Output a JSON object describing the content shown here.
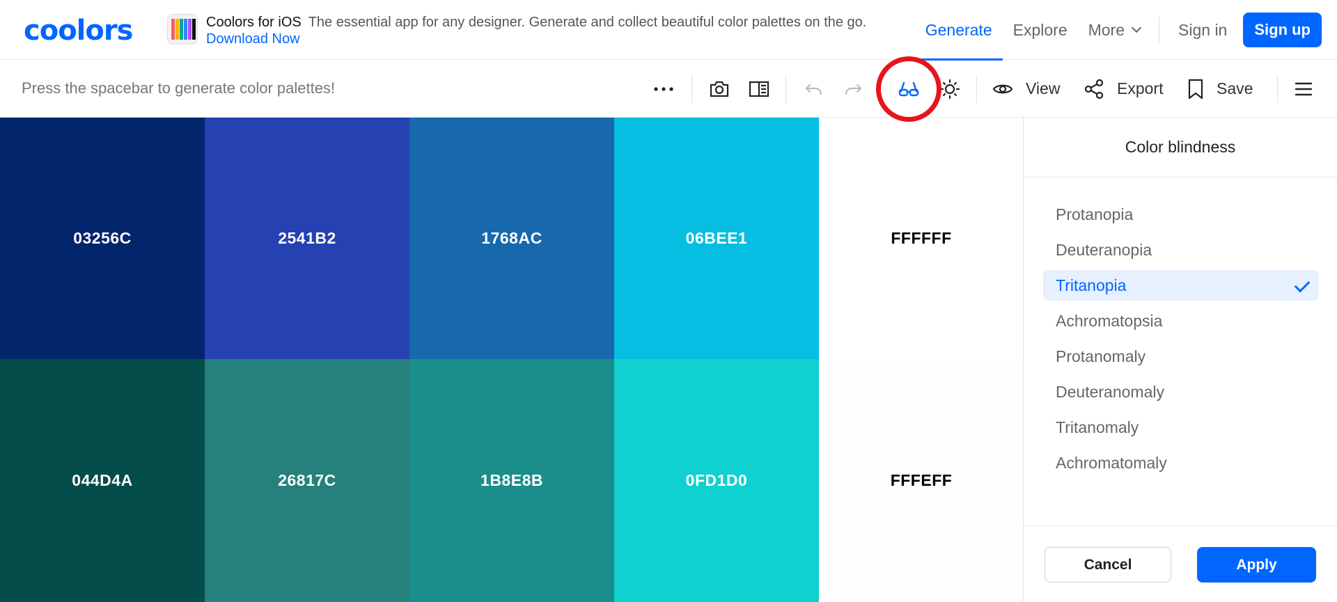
{
  "app": {
    "logo": "coolors"
  },
  "promo": {
    "title": "Coolors for iOS",
    "text": "The essential app for any designer. Generate and collect beautiful color palettes on the go.",
    "link": "Download Now"
  },
  "nav": {
    "generate": "Generate",
    "explore": "Explore",
    "more": "More",
    "sign_in": "Sign in",
    "sign_up": "Sign up"
  },
  "toolbar": {
    "hint": "Press the spacebar to generate color palettes!",
    "view": "View",
    "export": "Export",
    "save": "Save",
    "icons": [
      "more-dots-icon",
      "camera-icon",
      "compare-icon",
      "undo-icon",
      "redo-icon",
      "color-blindness-glasses-icon",
      "brightness-icon",
      "eye-icon",
      "share-icon",
      "bookmark-icon",
      "menu-icon"
    ]
  },
  "palette": {
    "original": [
      {
        "hex": "03256C",
        "color": "#03256C",
        "text_color": "#ffffff"
      },
      {
        "hex": "2541B2",
        "color": "#2541B2",
        "text_color": "#ffffff"
      },
      {
        "hex": "1768AC",
        "color": "#1768AC",
        "text_color": "#ffffff"
      },
      {
        "hex": "06BEE1",
        "color": "#06BEE1",
        "text_color": "#ffffff"
      },
      {
        "hex": "FFFFFF",
        "color": "#FFFFFF",
        "text_color": "#000000"
      }
    ],
    "simulated": [
      {
        "hex": "044D4A",
        "color": "#044D4A",
        "text_color": "#ffffff"
      },
      {
        "hex": "26817C",
        "color": "#26817C",
        "text_color": "#ffffff"
      },
      {
        "hex": "1B8E8B",
        "color": "#1B8E8B",
        "text_color": "#ffffff"
      },
      {
        "hex": "0FD1D0",
        "color": "#0FD1D0",
        "text_color": "#ffffff"
      },
      {
        "hex": "FFFEFF",
        "color": "#FFFEFF",
        "text_color": "#000000"
      }
    ]
  },
  "panel": {
    "title": "Color blindness",
    "options": [
      "Protanopia",
      "Deuteranopia",
      "Tritanopia",
      "Achromatopsia",
      "Protanomaly",
      "Deuteranomaly",
      "Tritanomaly",
      "Achromatomaly"
    ],
    "selected": "Tritanopia",
    "cancel": "Cancel",
    "apply": "Apply"
  },
  "colors": {
    "accent": "#0066ff",
    "highlight_ring": "#e8141c"
  }
}
